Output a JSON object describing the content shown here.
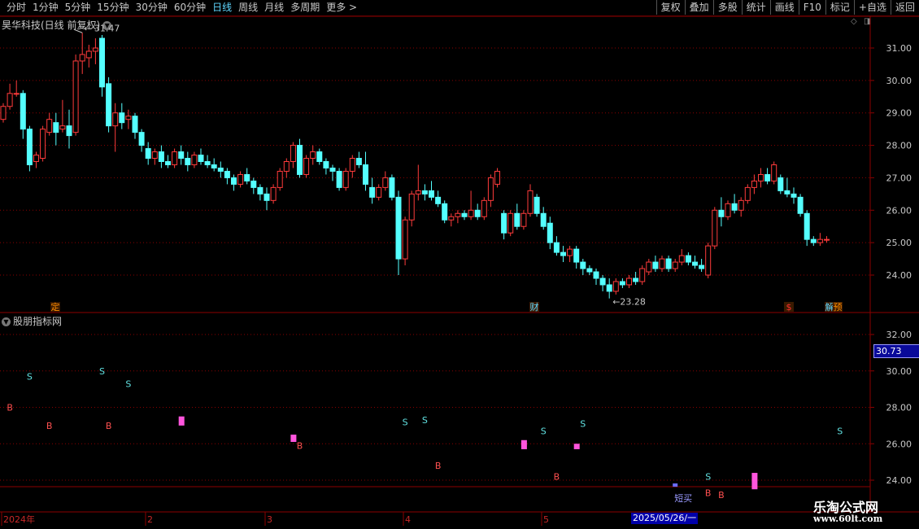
{
  "toolbar": {
    "periods": [
      "分时",
      "1分钟",
      "5分钟",
      "15分钟",
      "30分钟",
      "60分钟",
      "日线",
      "周线",
      "月线",
      "多周期",
      "更多 >"
    ],
    "active_period": "日线",
    "actions": [
      "复权",
      "叠加",
      "多股",
      "统计",
      "画线",
      "F10",
      "标记",
      "+自选",
      "返回"
    ]
  },
  "main_panel": {
    "title": "昊华科技(日线 前复权)",
    "high_label": "31.47",
    "low_label": "23.28",
    "event_markers": [
      {
        "label": "定",
        "color": "#ff8c00"
      },
      {
        "label": "财",
        "color": "#5fd7ff"
      },
      {
        "label": "$",
        "color": "#ff3030"
      },
      {
        "label": "解",
        "color": "#5fd7ff"
      },
      {
        "label": "预",
        "color": "#ff8c00"
      }
    ],
    "y_ticks": [
      "31.00",
      "30.00",
      "29.00",
      "28.00",
      "27.00",
      "26.00",
      "25.00",
      "24.00"
    ]
  },
  "sub_panel": {
    "title": "股朋指标网",
    "y_ticks": [
      "32.00",
      "30.00",
      "28.00",
      "26.00",
      "24.00"
    ],
    "current_value": "30.73",
    "short_buy_label": "短买"
  },
  "x_axis": {
    "labels": [
      "2024年",
      "2",
      "3",
      "4",
      "5"
    ],
    "cursor_date": "2025/05/26/一"
  },
  "watermark": {
    "name": "乐淘公式网",
    "url": "www.60lt.com"
  },
  "colors": {
    "up": "#ff3b3b",
    "down": "#54ffff",
    "grid": "#8b0000",
    "signal_b": "#ff5050",
    "signal_s": "#60e0e0",
    "bar": "#ff55dd"
  },
  "chart_data": [
    {
      "type": "candlestick",
      "title": "昊华科技(日线 前复权)",
      "ylim": [
        23.0,
        31.7
      ],
      "ohlc": [
        [
          28.8,
          29.3,
          28.7,
          29.2
        ],
        [
          29.2,
          29.9,
          29.1,
          29.6
        ],
        [
          29.6,
          30.0,
          29.5,
          29.6
        ],
        [
          29.6,
          29.7,
          28.2,
          28.5
        ],
        [
          28.5,
          28.6,
          27.2,
          27.4
        ],
        [
          27.5,
          27.8,
          27.3,
          27.7
        ],
        [
          27.6,
          28.6,
          27.5,
          28.5
        ],
        [
          28.4,
          29.0,
          28.3,
          28.8
        ],
        [
          28.7,
          29.0,
          28.0,
          28.4
        ],
        [
          28.5,
          29.4,
          28.4,
          28.6
        ],
        [
          28.6,
          29.1,
          27.9,
          28.3
        ],
        [
          28.4,
          30.8,
          28.3,
          30.6
        ],
        [
          30.6,
          31.47,
          30.2,
          30.8
        ],
        [
          30.7,
          31.1,
          30.4,
          30.9
        ],
        [
          30.9,
          31.3,
          30.5,
          31.0
        ],
        [
          31.3,
          31.4,
          29.5,
          29.8
        ],
        [
          29.9,
          30.1,
          28.4,
          28.6
        ],
        [
          28.6,
          29.3,
          27.8,
          29.0
        ],
        [
          29.0,
          29.3,
          28.5,
          28.7
        ],
        [
          28.8,
          29.1,
          28.5,
          28.9
        ],
        [
          28.9,
          29.0,
          28.2,
          28.4
        ],
        [
          28.4,
          28.5,
          27.8,
          28.0
        ],
        [
          27.9,
          28.1,
          27.4,
          27.6
        ],
        [
          27.6,
          27.9,
          27.4,
          27.8
        ],
        [
          27.8,
          28.0,
          27.3,
          27.5
        ],
        [
          27.5,
          27.7,
          27.3,
          27.4
        ],
        [
          27.4,
          27.9,
          27.3,
          27.8
        ],
        [
          27.8,
          28.0,
          27.4,
          27.6
        ],
        [
          27.6,
          27.8,
          27.2,
          27.4
        ],
        [
          27.4,
          27.8,
          27.3,
          27.7
        ],
        [
          27.7,
          27.9,
          27.4,
          27.5
        ],
        [
          27.5,
          27.7,
          27.3,
          27.4
        ],
        [
          27.4,
          27.6,
          27.2,
          27.3
        ],
        [
          27.3,
          27.5,
          27.0,
          27.2
        ],
        [
          27.2,
          27.3,
          26.8,
          27.0
        ],
        [
          27.0,
          27.1,
          26.6,
          26.8
        ],
        [
          26.8,
          27.2,
          26.7,
          27.1
        ],
        [
          27.1,
          27.3,
          26.8,
          26.9
        ],
        [
          26.9,
          27.0,
          26.5,
          26.7
        ],
        [
          26.7,
          26.8,
          26.3,
          26.5
        ],
        [
          26.5,
          26.7,
          26.0,
          26.3
        ],
        [
          26.3,
          26.8,
          26.2,
          26.7
        ],
        [
          26.7,
          27.3,
          26.6,
          27.2
        ],
        [
          27.2,
          27.6,
          27.0,
          27.5
        ],
        [
          27.5,
          28.1,
          27.3,
          28.0
        ],
        [
          28.0,
          28.2,
          27.0,
          27.1
        ],
        [
          27.1,
          27.7,
          27.0,
          27.6
        ],
        [
          27.6,
          28.0,
          27.4,
          27.8
        ],
        [
          27.8,
          27.9,
          27.4,
          27.5
        ],
        [
          27.5,
          27.6,
          27.1,
          27.3
        ],
        [
          27.3,
          27.4,
          26.9,
          27.2
        ],
        [
          27.2,
          27.3,
          26.6,
          26.7
        ],
        [
          26.7,
          27.3,
          26.6,
          27.2
        ],
        [
          27.2,
          27.7,
          27.0,
          27.6
        ],
        [
          27.6,
          27.8,
          27.3,
          27.4
        ],
        [
          27.4,
          27.8,
          26.6,
          26.8
        ],
        [
          26.7,
          27.0,
          26.2,
          26.4
        ],
        [
          26.4,
          26.8,
          26.3,
          26.7
        ],
        [
          26.7,
          27.2,
          26.6,
          27.0
        ],
        [
          27.0,
          27.1,
          26.3,
          26.4
        ],
        [
          26.4,
          26.6,
          24.0,
          24.5
        ],
        [
          24.5,
          25.8,
          24.3,
          25.7
        ],
        [
          25.7,
          26.6,
          25.5,
          26.5
        ],
        [
          26.5,
          27.4,
          26.3,
          26.6
        ],
        [
          26.6,
          26.8,
          26.3,
          26.5
        ],
        [
          26.6,
          26.9,
          26.3,
          26.4
        ],
        [
          26.4,
          26.6,
          26.1,
          26.2
        ],
        [
          26.2,
          26.3,
          25.6,
          25.7
        ],
        [
          25.7,
          25.9,
          25.5,
          25.8
        ],
        [
          25.8,
          26.0,
          25.6,
          25.9
        ],
        [
          25.9,
          26.0,
          25.7,
          25.8
        ],
        [
          25.8,
          26.6,
          25.7,
          26.0
        ],
        [
          26.0,
          26.2,
          25.7,
          25.8
        ],
        [
          25.8,
          26.4,
          25.7,
          26.3
        ],
        [
          26.3,
          27.1,
          26.1,
          27.0
        ],
        [
          26.8,
          27.3,
          26.7,
          27.2
        ],
        [
          25.9,
          26.0,
          25.1,
          25.3
        ],
        [
          25.3,
          26.0,
          25.2,
          25.9
        ],
        [
          25.9,
          26.2,
          25.4,
          25.5
        ],
        [
          25.5,
          26.0,
          25.4,
          25.9
        ],
        [
          25.9,
          26.8,
          25.8,
          26.6
        ],
        [
          26.4,
          26.5,
          25.8,
          25.9
        ],
        [
          25.9,
          26.1,
          25.4,
          25.5
        ],
        [
          25.6,
          25.8,
          24.8,
          25.0
        ],
        [
          25.0,
          25.2,
          24.6,
          24.7
        ],
        [
          24.7,
          24.9,
          24.4,
          24.6
        ],
        [
          24.6,
          24.9,
          24.4,
          24.8
        ],
        [
          24.8,
          24.9,
          24.2,
          24.4
        ],
        [
          24.4,
          24.5,
          24.0,
          24.2
        ],
        [
          24.2,
          24.3,
          24.0,
          24.1
        ],
        [
          24.1,
          24.2,
          23.7,
          23.9
        ],
        [
          23.9,
          24.0,
          23.5,
          23.7
        ],
        [
          23.7,
          23.9,
          23.28,
          23.5
        ],
        [
          23.5,
          23.9,
          23.4,
          23.8
        ],
        [
          23.8,
          23.9,
          23.6,
          23.7
        ],
        [
          23.7,
          24.0,
          23.6,
          23.9
        ],
        [
          23.9,
          24.1,
          23.7,
          23.8
        ],
        [
          23.8,
          24.3,
          23.7,
          24.2
        ],
        [
          24.1,
          24.5,
          24.0,
          24.4
        ],
        [
          24.4,
          24.6,
          24.1,
          24.2
        ],
        [
          24.2,
          24.6,
          24.1,
          24.5
        ],
        [
          24.5,
          24.6,
          24.1,
          24.2
        ],
        [
          24.2,
          24.5,
          24.1,
          24.4
        ],
        [
          24.4,
          24.8,
          24.3,
          24.6
        ],
        [
          24.6,
          24.7,
          24.3,
          24.4
        ],
        [
          24.4,
          24.6,
          24.2,
          24.3
        ],
        [
          24.3,
          24.5,
          24.1,
          24.2
        ],
        [
          24.0,
          25.0,
          23.9,
          24.9
        ],
        [
          24.9,
          26.1,
          24.8,
          26.0
        ],
        [
          26.0,
          26.4,
          25.5,
          25.8
        ],
        [
          25.8,
          26.3,
          25.7,
          26.2
        ],
        [
          26.2,
          26.5,
          25.9,
          26.0
        ],
        [
          26.0,
          26.4,
          25.8,
          26.3
        ],
        [
          26.3,
          26.8,
          26.2,
          26.7
        ],
        [
          26.7,
          27.1,
          26.5,
          26.9
        ],
        [
          26.9,
          27.3,
          26.7,
          27.1
        ],
        [
          27.1,
          27.3,
          26.8,
          26.9
        ],
        [
          26.9,
          27.5,
          26.8,
          27.4
        ],
        [
          27.0,
          27.1,
          26.5,
          26.6
        ],
        [
          26.6,
          27.0,
          26.4,
          26.5
        ],
        [
          26.5,
          26.7,
          26.2,
          26.4
        ],
        [
          26.4,
          26.5,
          25.8,
          25.9
        ],
        [
          25.9,
          26.0,
          24.9,
          25.1
        ],
        [
          25.1,
          25.2,
          24.9,
          25.0
        ],
        [
          25.0,
          25.3,
          24.9,
          25.1
        ],
        [
          25.1,
          25.2,
          25.0,
          25.1
        ]
      ]
    },
    {
      "type": "scatter",
      "title": "股朋指标网",
      "ylim": [
        23.3,
        32.8
      ],
      "signals_b": [
        [
          1,
          28.0
        ],
        [
          7,
          27.0
        ],
        [
          16,
          27.0
        ],
        [
          45,
          25.9
        ],
        [
          66,
          24.8
        ],
        [
          84,
          24.2
        ],
        [
          107,
          23.3
        ],
        [
          109,
          23.2
        ]
      ],
      "signals_s": [
        [
          4,
          29.7
        ],
        [
          15,
          30.0
        ],
        [
          19,
          29.3
        ],
        [
          61,
          27.2
        ],
        [
          64,
          27.3
        ],
        [
          82,
          26.7
        ],
        [
          88,
          27.1
        ],
        [
          107,
          24.2
        ],
        [
          127,
          26.7
        ]
      ],
      "bars": [
        [
          27,
          27.0,
          27.5
        ],
        [
          44,
          26.1,
          26.5
        ],
        [
          79,
          25.7,
          26.2
        ],
        [
          87,
          25.7,
          26.0
        ],
        [
          114,
          23.5,
          24.4
        ]
      ],
      "short_buy": [
        102,
        23.5
      ]
    }
  ]
}
